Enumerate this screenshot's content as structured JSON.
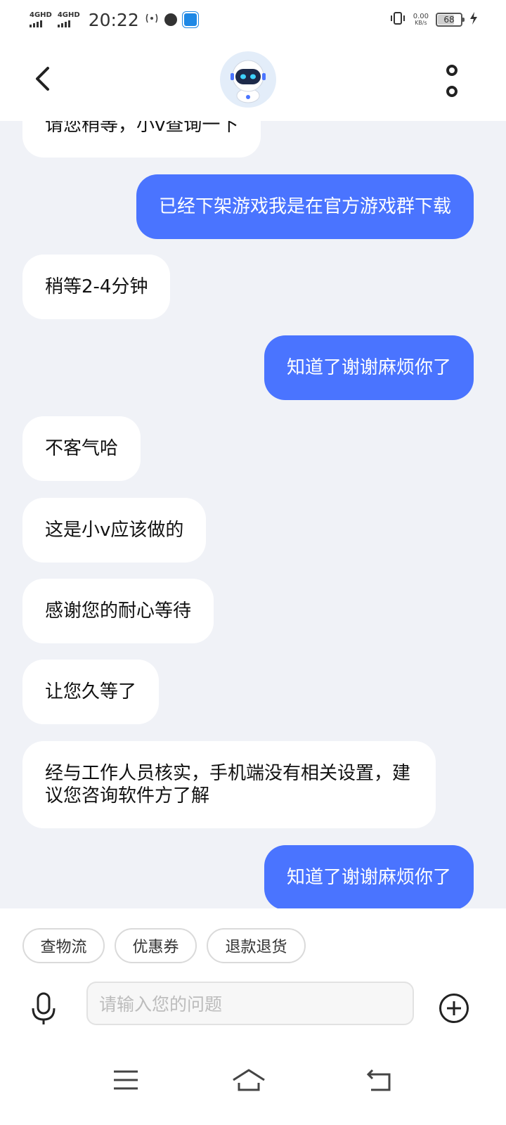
{
  "status_bar": {
    "network_1": "4GHD",
    "network_2": "4GHD",
    "time": "20:22",
    "wifi_icon": "wifi-signal-icon",
    "speed_value": "0.00",
    "speed_unit": "KB/s",
    "battery_level": "68",
    "battery_fraction": 0.68
  },
  "header": {
    "avatar_icon": "robot-avatar-icon"
  },
  "messages": [
    {
      "side": "in",
      "text": "请您稍等，小v查询一下"
    },
    {
      "side": "out",
      "text": "已经下架游戏我是在官方游戏群下载"
    },
    {
      "side": "in",
      "text": "稍等2-4分钟"
    },
    {
      "side": "out",
      "text": "知道了谢谢麻烦你了"
    },
    {
      "side": "in",
      "text": "不客气哈"
    },
    {
      "side": "in",
      "text": "这是小v应该做的"
    },
    {
      "side": "in",
      "text": "感谢您的耐心等待"
    },
    {
      "side": "in",
      "text": "让您久等了"
    },
    {
      "side": "in",
      "text": "经与工作人员核实，手机端没有相关设置，建议您咨询软件方了解"
    },
    {
      "side": "out",
      "text": "知道了谢谢麻烦你了"
    }
  ],
  "quick_actions": [
    "查物流",
    "优惠券",
    "退款退货"
  ],
  "input": {
    "placeholder": "请输入您的问题"
  },
  "colors": {
    "outgoing_bubble": "#4a74ff",
    "incoming_bubble": "#ffffff",
    "chat_background": "#f0f2f7"
  }
}
